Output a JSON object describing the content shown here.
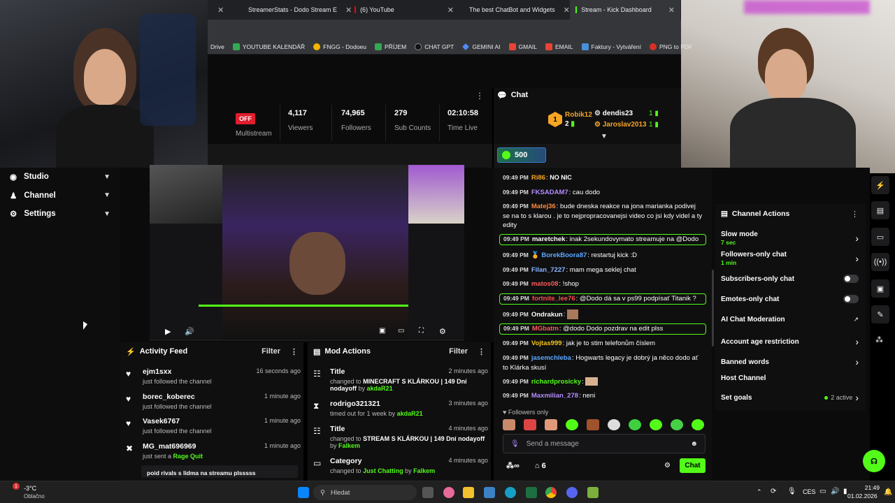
{
  "browser": {
    "tabs": [
      {
        "label": "",
        "color": "#5f6368"
      },
      {
        "label": "StreamerStats - Dodo Stream E",
        "color": "#e8a000"
      },
      {
        "label": "(6) YouTube",
        "color": "#ff0000"
      },
      {
        "label": "The best ChatBot and Widgets",
        "color": "#ffffff"
      },
      {
        "label": "Stream - Kick Dashboard",
        "color": "#53fc18"
      }
    ],
    "bookmarks": [
      {
        "label": "Drive",
        "color": ""
      },
      {
        "label": "YOUTUBE KALENDÁŘ",
        "color": "#34a853"
      },
      {
        "label": "FNGG - Dodoeu",
        "color": "#f4b400"
      },
      {
        "label": "PŘÍJEM",
        "color": "#34a853"
      },
      {
        "label": "CHAT GPT",
        "color": "#202124"
      },
      {
        "label": "GEMINI AI",
        "color": "#4c8bf5"
      },
      {
        "label": "GMAIL",
        "color": "#ea4335"
      },
      {
        "label": "EMAIL",
        "color": "#ea4335"
      },
      {
        "label": "Faktury - Vytváření",
        "color": "#4a90d9"
      },
      {
        "label": "PNG to PDF",
        "color": "#d93025"
      }
    ]
  },
  "stats": {
    "status": "OFF",
    "multistream": "Multistream",
    "viewers_value": "4,117",
    "viewers_label": "Viewers",
    "followers_value": "74,965",
    "followers_label": "Followers",
    "subs_value": "279",
    "subs_label": "Sub Counts",
    "time_value": "02:10:58",
    "time_label": "Time Live"
  },
  "chat_header": {
    "title": "Chat",
    "leaderboard": [
      {
        "name": "Robik12",
        "count": "1"
      },
      {
        "name": "dendis23",
        "count": "1"
      },
      {
        "name": "Jaroslav2013",
        "count": "1"
      }
    ],
    "rank_badge": "1",
    "rank_sub": "2",
    "pill_value": "500"
  },
  "sidebar": {
    "items": [
      {
        "label": "Studio"
      },
      {
        "label": "Channel"
      },
      {
        "label": "Settings"
      }
    ]
  },
  "activity_feed": {
    "title": "Activity Feed",
    "filter": "Filter",
    "rows": [
      {
        "name": "ejm1sxx",
        "sub": "just followed the channel",
        "time": "16 seconds ago"
      },
      {
        "name": "borec_koberec",
        "sub": "just followed the channel",
        "time": "1 minute ago"
      },
      {
        "name": "Vasek6767",
        "sub": "just followed the channel",
        "time": "1 minute ago"
      },
      {
        "name": "MG_mat696969",
        "sub": "just sent a",
        "sub_highlight": "Rage Quit",
        "time": "1 minute ago"
      }
    ],
    "partial": "poid rivals s lidma na streamu plsssss"
  },
  "mod_actions": {
    "title": "Mod Actions",
    "filter": "Filter",
    "rows": [
      {
        "name": "Title",
        "pre": "changed to",
        "bold": "MINECRAFT S KLÁRKOU | 149 Dní nodayoff",
        "by": "by",
        "mod": "akdaR21",
        "time": "2 minutes ago"
      },
      {
        "name": "rodrigo321321",
        "pre": "timed out for 1 week",
        "bold": "",
        "by": "by",
        "mod": "akdaR21",
        "time": "3 minutes ago"
      },
      {
        "name": "Title",
        "pre": "changed to",
        "bold": "STREAM S KLÁRKOU | 149 Dní nodayoff",
        "by": "by",
        "mod": "Falkem",
        "time": "4 minutes ago"
      },
      {
        "name": "Category",
        "pre": "changed to",
        "bold": "Just Chatting",
        "by": "by",
        "mod": "Falkem",
        "time": "4 minutes ago"
      }
    ]
  },
  "chat": {
    "messages": [
      {
        "time": "09:49 PM",
        "user": "Ri86",
        "color": "#f5a524",
        "text": "NO NIC",
        "hl": false
      },
      {
        "time": "09:49 PM",
        "user": "FKSADAM7",
        "color": "#b48cff",
        "text": "cau dodo",
        "hl": false
      },
      {
        "time": "09:49 PM",
        "user": "Matej36",
        "color": "#ff8a3d",
        "text": "bude dneska reakce na jona marianka podivej se na to s klarou . je to nejpropracovanejsi video co jsi kdy videl a ty edity",
        "hl": false
      },
      {
        "time": "09:49 PM",
        "user": "maretchek",
        "color": "#ffffff",
        "text": "inak 2sekundovymato streamuje na @Dodo",
        "hl": true
      },
      {
        "time": "09:49 PM",
        "user": "BorekBoora87",
        "color": "#5aa9ff",
        "text": "restartuj kick :D",
        "hl": false
      },
      {
        "time": "09:49 PM",
        "user": "Filan_7227",
        "color": "#8ab4ff",
        "text": "mam mega seklej chat",
        "hl": false
      },
      {
        "time": "09:49 PM",
        "user": "matos08",
        "color": "#ff5a5a",
        "text": "!shop",
        "hl": false
      },
      {
        "time": "09:49 PM",
        "user": "fortnite_lee76",
        "color": "#ff4d4d",
        "text": "@Dodo dá sa v ps99 podpísať Titanik ?",
        "hl": true
      },
      {
        "time": "09:49 PM",
        "user": "Ondrakun",
        "color": "#ffffff",
        "text": "",
        "hl": false
      },
      {
        "time": "09:49 PM",
        "user": "MGbatm",
        "color": "#ff5a5a",
        "text": "@dodo Dodo pozdrav na edit plss",
        "hl": true
      },
      {
        "time": "09:49 PM",
        "user": "Vojtas999",
        "color": "#f5c518",
        "text": "jak je to stim telefonům číslem",
        "hl": false
      },
      {
        "time": "09:49 PM",
        "user": "jasemchleba",
        "color": "#5aa9ff",
        "text": "Hogwarts legacy je dobrý ja něco dodo ať to Klárka skusí",
        "hl": false
      },
      {
        "time": "09:49 PM",
        "user": "richardprosicky",
        "color": "#53fc18",
        "text": "",
        "hl": false
      },
      {
        "time": "09:49 PM",
        "user": "Maxmilian_278",
        "color": "#b48cff",
        "text": "neni",
        "hl": false
      }
    ],
    "followers_only": "Followers only",
    "input_placeholder": "Send a message",
    "viewers_count": "6",
    "send_label": "Chat"
  },
  "channel_actions": {
    "title": "Channel Actions",
    "items": [
      {
        "label": "Slow mode",
        "sub": "7 sec",
        "type": "chevron"
      },
      {
        "label": "Followers-only chat",
        "sub": "1 min",
        "type": "chevron"
      },
      {
        "label": "Subscribers-only chat",
        "sub": "",
        "type": "toggle"
      },
      {
        "label": "Emotes-only chat",
        "sub": "",
        "type": "toggle"
      },
      {
        "label": "AI Chat Moderation",
        "sub": "",
        "type": "external"
      },
      {
        "label": "Account age restriction",
        "sub": "",
        "type": "chevron"
      },
      {
        "label": "Banned words",
        "sub": "",
        "type": "chevron"
      },
      {
        "label": "Host Channel",
        "sub": "",
        "type": "none"
      },
      {
        "label": "Set goals",
        "sub": "",
        "type": "active",
        "side": "2 active"
      }
    ]
  },
  "taskbar": {
    "weather_temp": "-3°C",
    "weather_desc": "Oblačno",
    "notif_count": "1",
    "search_placeholder": "Hledat",
    "lang": "CES",
    "time": "21:49",
    "date": "01.02.2026"
  }
}
